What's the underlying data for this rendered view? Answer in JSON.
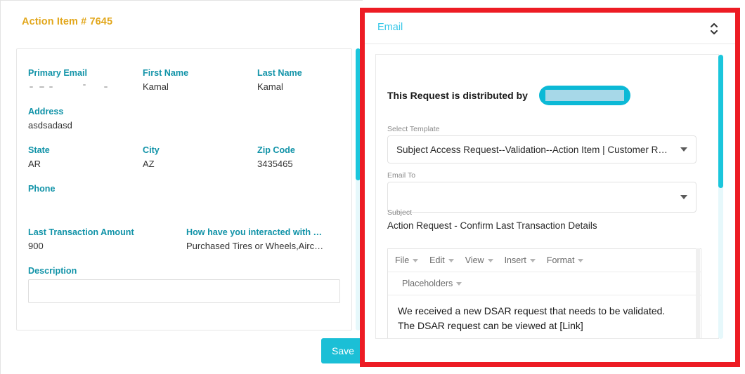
{
  "left_panel": {
    "title": "Action Item # 7645",
    "fields": {
      "primary_email_label": "Primary Email",
      "primary_email_value": "",
      "first_name_label": "First Name",
      "first_name_value": "Kamal",
      "last_name_label": "Last Name",
      "last_name_value": "Kamal",
      "address_label": "Address",
      "address_value": "asdsadasd",
      "state_label": "State",
      "state_value": "AR",
      "city_label": "City",
      "city_value": "AZ",
      "zip_label": "Zip Code",
      "zip_value": "3435465",
      "phone_label": "Phone",
      "phone_value": "",
      "last_transaction_label": "Last Transaction Amount",
      "last_transaction_value": "900",
      "interaction_label": "How have you interacted with …",
      "interaction_value": "Purchased Tires or Wheels,Airc…",
      "description_label": "Description",
      "description_value": ""
    },
    "save_label": "Save"
  },
  "right_panel": {
    "header_title": "Email",
    "collapse_icon": "chevron-up-down-icon",
    "distributed_by_label": "This Request is distributed by",
    "distributed_by_value": "",
    "select_template": {
      "label": "Select Template",
      "value": "Subject Access Request--Validation--Action Item | Customer R…"
    },
    "email_to": {
      "label": "Email To",
      "value": ""
    },
    "subject": {
      "label": "Subject",
      "value": "Action Request - Confirm Last Transaction Details"
    },
    "editor": {
      "menu_items": [
        "File",
        "Edit",
        "View",
        "Insert",
        "Format"
      ],
      "toolbar_items": [
        "Placeholders"
      ],
      "body_line_1": "We received a new DSAR request that needs to be validated.",
      "body_line_2": "The DSAR request can be viewed at [Link]"
    }
  },
  "colors": {
    "accent_cyan": "#1BBFD6",
    "label_teal": "#1193A8",
    "title_gold": "#E2A71C",
    "highlight_red": "#ED1C24",
    "email_header_blue": "#36C7E8"
  }
}
